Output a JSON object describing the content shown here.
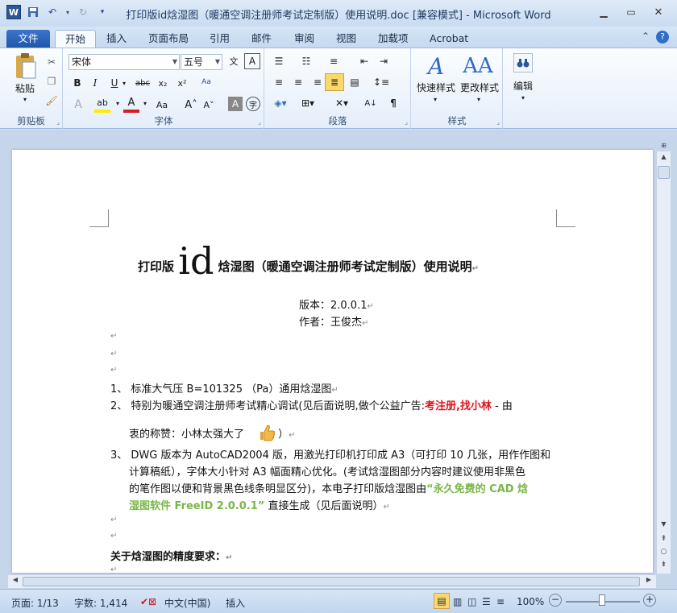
{
  "window": {
    "title": "打印版id焓湿图（暖通空调注册师考试定制版）使用说明.doc [兼容模式] - Microsoft Word",
    "app_icon_label": "W"
  },
  "tabs": [
    {
      "label": "文件"
    },
    {
      "label": "开始"
    },
    {
      "label": "插入"
    },
    {
      "label": "页面布局"
    },
    {
      "label": "引用"
    },
    {
      "label": "邮件"
    },
    {
      "label": "审阅"
    },
    {
      "label": "视图"
    },
    {
      "label": "加载项"
    },
    {
      "label": "Acrobat"
    }
  ],
  "ribbon": {
    "clipboard": {
      "label": "剪贴板",
      "paste": "粘贴"
    },
    "font": {
      "label": "字体",
      "font_name": "宋体",
      "font_size": "五号"
    },
    "paragraph": {
      "label": "段落"
    },
    "styles": {
      "label": "样式",
      "quick": "快速样式",
      "change": "更改样式"
    },
    "editing": {
      "label": "编辑"
    }
  },
  "doc": {
    "title_pre": "打印版",
    "title_id": "id",
    "title_post": "焓湿图（暖通空调注册师考试定制版）使用说明",
    "version": "版本：2.0.0.1",
    "author": "作者：王俊杰",
    "item1": "1、 标准大气压  B=101325  （Pa）通用焓湿图",
    "item2a": "2、 特别为暖通空调注册师考试精心调试(见后面说明,做个公益广告:",
    "item2_red": "考注册,找小林",
    "item2b": " - 由",
    "item2c": "衷的称赞：小林太强大了",
    "item2d": "）",
    "item3a": "3、 DWG 版本为 AutoCAD2004 版，用激光打印机打印成 A3（可打印 10 几张，用作作图和",
    "item3b": "计算稿纸），字体大小针对 A3 幅面精心优化。(考试焓湿图部分内容时建议使用非黑色",
    "item3c": "的笔作图以便和背景黑色线条明显区分)，本电子打印版焓湿图由",
    "item3_green1": "“永久免费的 CAD 焓",
    "item3_green2": "湿图软件 FreeID 2.0.0.1”",
    "item3d": " 直接生成（见后面说明）",
    "heading": "关于焓湿图的精度要求："
  },
  "status": {
    "page": "页面: 1/13",
    "words": "字数: 1,414",
    "lang": "中文(中国)",
    "mode": "插入",
    "zoom": "100%"
  }
}
